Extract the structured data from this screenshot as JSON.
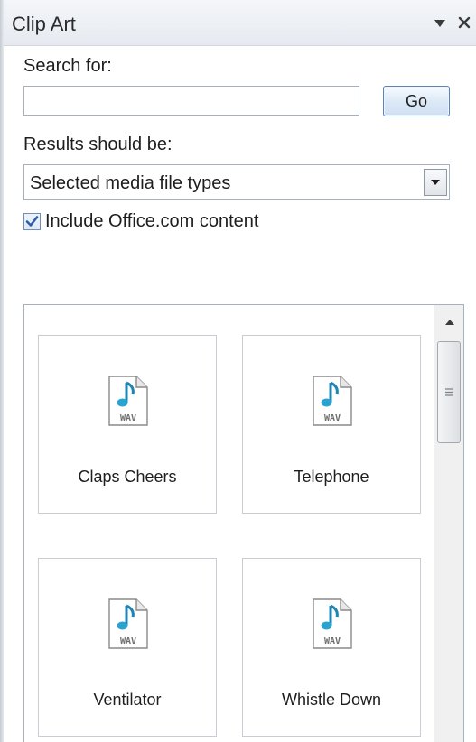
{
  "pane": {
    "title": "Clip Art",
    "dropdown_icon": "chevron-down-icon",
    "close_icon": "close-icon"
  },
  "search": {
    "label": "Search for:",
    "value": "",
    "placeholder": "",
    "go_label": "Go"
  },
  "results_filter": {
    "label": "Results should be:",
    "selected": "Selected media file types"
  },
  "office_content": {
    "label": "Include Office.com content",
    "checked": true
  },
  "clips": [
    {
      "name": "Claps Cheers",
      "icon": "wav-file-icon",
      "icon_text": "WAV"
    },
    {
      "name": "Telephone",
      "icon": "wav-file-icon",
      "icon_text": "WAV"
    },
    {
      "name": "Ventilator",
      "icon": "wav-file-icon",
      "icon_text": "WAV"
    },
    {
      "name": "Whistle Down",
      "icon": "wav-file-icon",
      "icon_text": "WAV"
    }
  ],
  "colors": {
    "accent": "#2a8fb8",
    "button_border": "#5c84b8",
    "checkmark": "#2d5fa8"
  }
}
